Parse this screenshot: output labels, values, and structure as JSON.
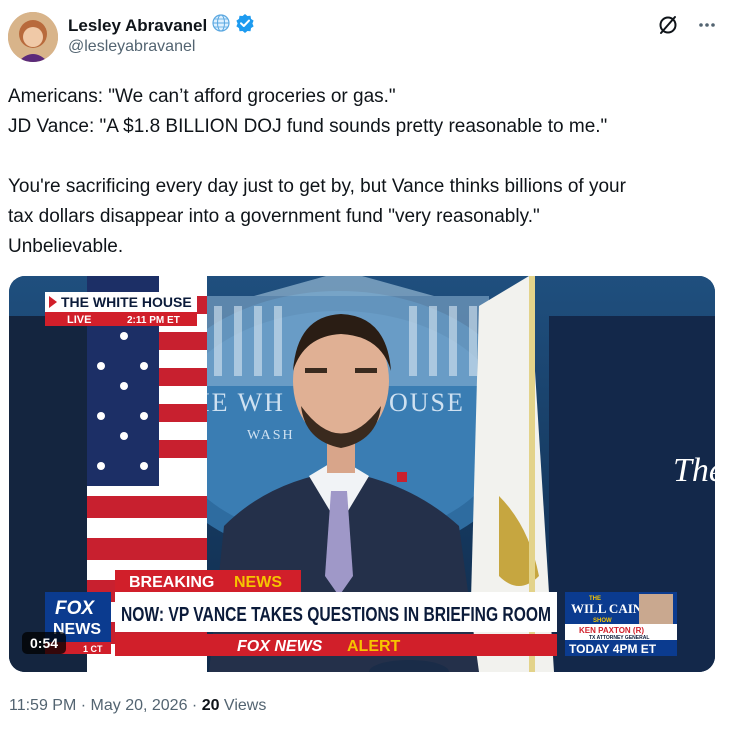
{
  "author": {
    "name": "Lesley Abravanel",
    "handle": "@lesleyabravanel"
  },
  "post": {
    "line1": "Americans: \"We can’t afford groceries or gas.\"",
    "line2": "JD Vance: \"A $1.8 BILLION DOJ fund sounds pretty reasonable to me.\"",
    "line3": "You're sacrificing every day just to get by, but Vance thinks billions of your",
    "line4": "tax dollars disappear into a government fund \"very reasonably.\"",
    "line5": "Unbelievable."
  },
  "video": {
    "location_tag": "THE WHITE HOUSE",
    "live_label": "LIVE",
    "live_time": "2:11 PM ET",
    "backdrop_seal_text_left": "THE WH",
    "backdrop_seal_text_right": "OUSE",
    "backdrop_seal_sub": "WASH",
    "backdrop_right_text": "The",
    "breaking_1": "BREAKING",
    "breaking_2": "NEWS",
    "headline": "NOW: VP VANCE TAKES QUESTIONS IN BRIEFING ROOM",
    "alert_brand": "FOX NEWS",
    "alert_label": "ALERT",
    "fox_logo_1": "FOX",
    "fox_logo_2": "NEWS",
    "fox_time": "1 CT",
    "promo_show_1": "THE",
    "promo_show_2": "WILL CAIN",
    "promo_show_3": "SHOW",
    "promo_guest": "KEN PAXTON (R)",
    "promo_guest_title": "TX ATTORNEY GENERAL",
    "promo_time": "TODAY 4PM ET",
    "duration": "0:54"
  },
  "meta": {
    "timestamp": "11:59 PM · May 20, 2026 · ",
    "views_count": "20",
    "views_label": " Views"
  },
  "colors": {
    "verified": "#1d9bf0",
    "fox_red": "#d11f2a",
    "fox_blue": "#0b3b8f"
  },
  "icons": [
    "globe-icon",
    "verified-badge-icon",
    "grok-icon",
    "more-icon"
  ]
}
